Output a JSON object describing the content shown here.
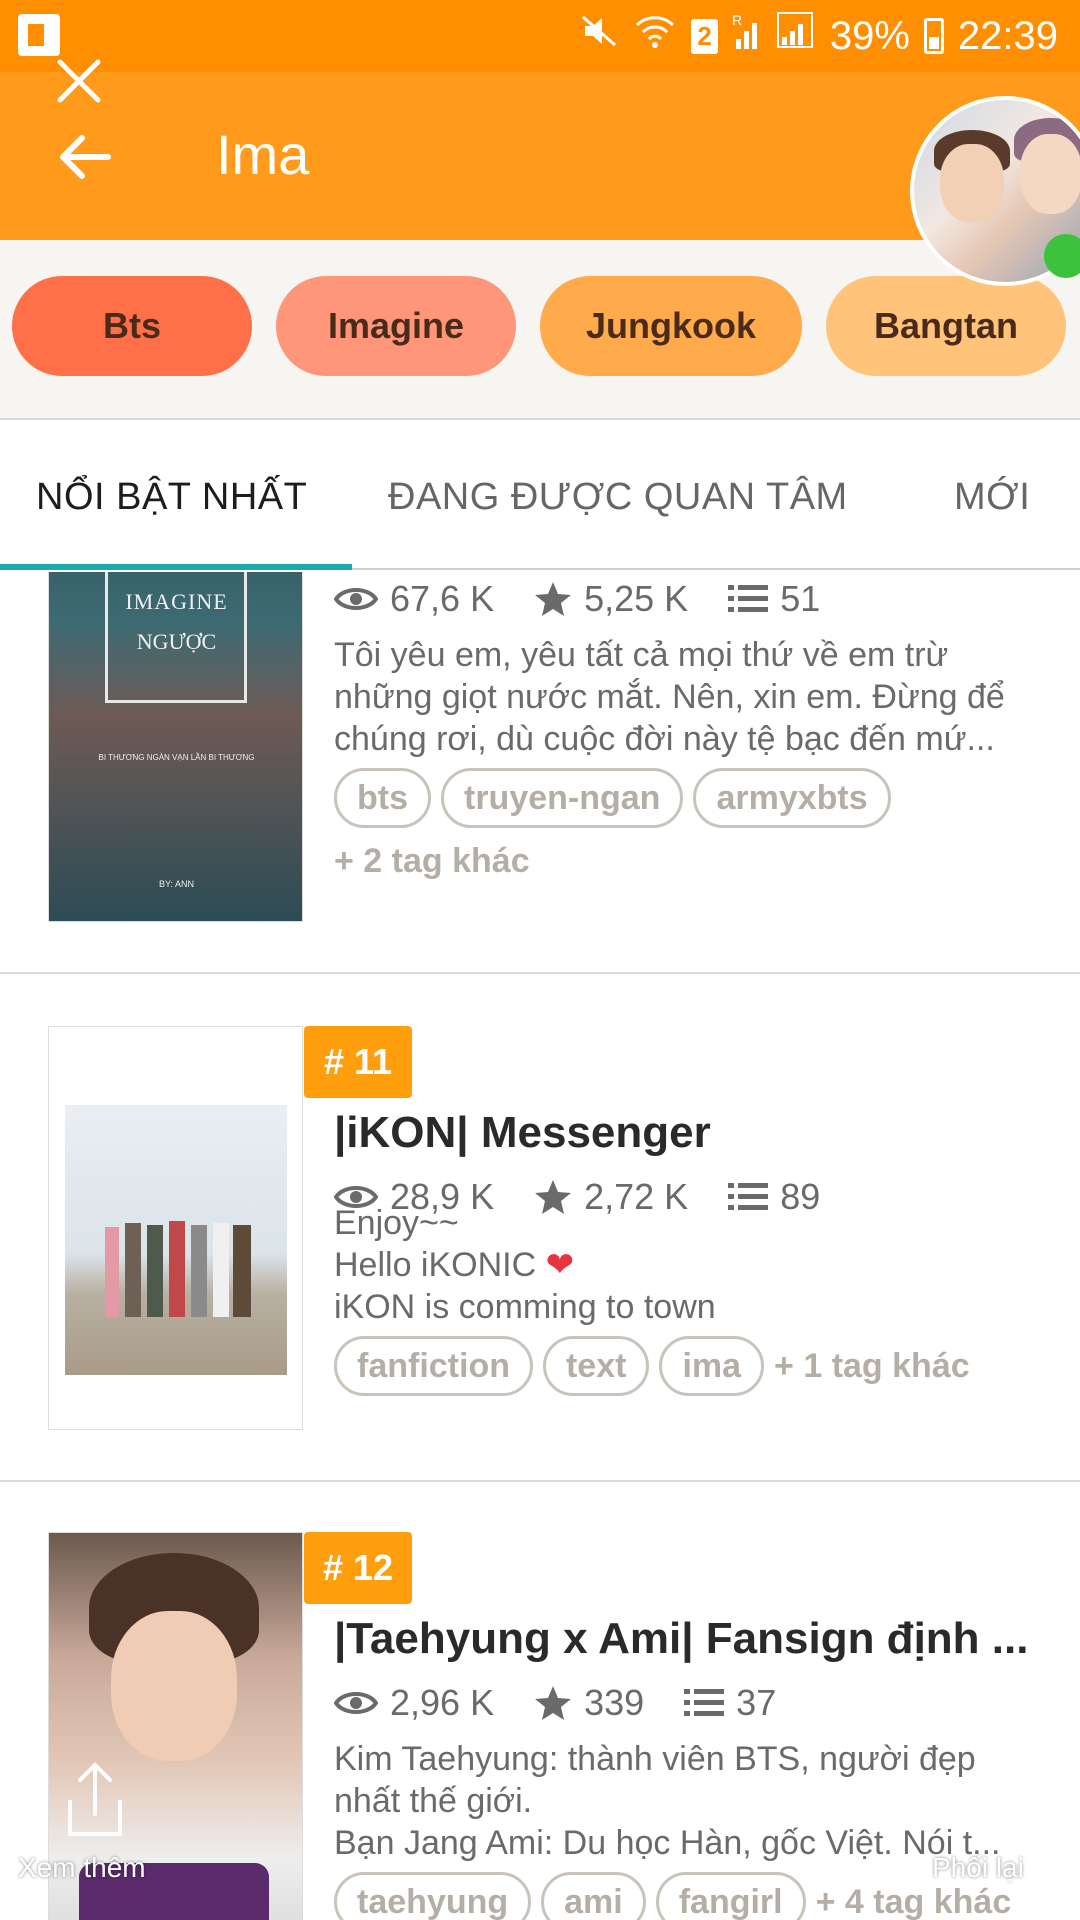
{
  "status_bar": {
    "battery": "39%",
    "time": "22:39",
    "sim": "2"
  },
  "app_bar": {
    "title": "Ima"
  },
  "tags": [
    {
      "label": "Bts",
      "color": "#ff7049"
    },
    {
      "label": "Imagine",
      "color": "#ff9579"
    },
    {
      "label": "Jungkook",
      "color": "#ffaa4b"
    },
    {
      "label": "Bangtan",
      "color": "#ffc37a"
    }
  ],
  "tabs": [
    {
      "label": "NỔI BẬT NHẤT"
    },
    {
      "label": "ĐANG ĐƯỢC QUAN TÂM"
    },
    {
      "label": "MỚI"
    }
  ],
  "stories": [
    {
      "cover_title": "IMAGINE",
      "cover_subtitle": "NGƯỢC",
      "cover_small": "BI THƯƠNG NGÀN VẠN LẦN BI THƯƠNG",
      "cover_author": "BY: ANN",
      "reads": "67,6 K",
      "votes": "5,25 K",
      "parts": "51",
      "description": [
        "Tôi yêu em, yêu tất cả mọi thứ về em trừ",
        "những giọt nước mắt. Nên, xin em. Đừng để",
        "chúng rơi, dù cuộc đời này tệ bạc đến mứ..."
      ],
      "tags": [
        "bts",
        "truyen-ngan",
        "armyxbts"
      ],
      "more_tags": "+ 2 tag khác"
    },
    {
      "rank": "# 11",
      "title": "|iKON| Messenger",
      "reads": "28,9 K",
      "votes": "2,72 K",
      "parts": "89",
      "description": [
        "Enjoy~~",
        "Hello iKONIC",
        "iKON is comming to town"
      ],
      "tags": [
        "fanfiction",
        "text",
        "ima"
      ],
      "more_tags": "+ 1 tag khác"
    },
    {
      "rank": "# 12",
      "title": "|Taehyung x Ami| Fansign định ...",
      "reads": "2,96 K",
      "votes": "339",
      "parts": "37",
      "description": [
        "Kim Taehyung: thành viên BTS, người đẹp",
        "nhất thế giới.",
        "Bạn Jang Ami: Du học Hàn, gốc Việt. Nói t..."
      ],
      "tags": [
        "taehyung",
        "ami",
        "fangirl"
      ],
      "more_tags": "+ 4 tag khác"
    }
  ],
  "floating": {
    "share_label": "Xem thêm",
    "edit_label": "Phối lại"
  },
  "colors": {
    "status_bar": "#ff8f00",
    "app_bar": "#ff9a1a",
    "rank_badge": "#ff9f0e",
    "tab_indicator": "#1aa9ad"
  }
}
